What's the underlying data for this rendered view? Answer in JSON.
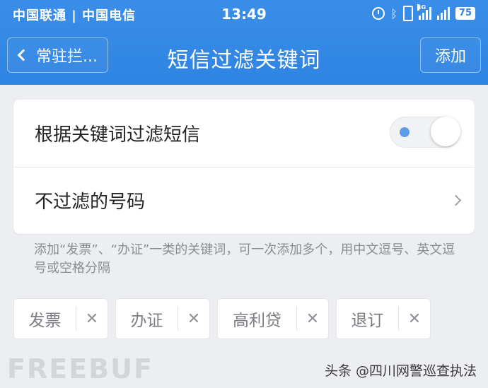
{
  "status_bar": {
    "carrier": "中国联通 | 中国电信",
    "time": "13:49",
    "network": "4G",
    "battery": "75",
    "icons": [
      "alarm-icon",
      "bluetooth-icon",
      "vibrate-icon",
      "signal-icon",
      "signal-icon"
    ]
  },
  "nav": {
    "back_label": "常驻拦...",
    "title": "短信过滤关键词",
    "add_label": "添加"
  },
  "settings": {
    "filter_by_keyword_label": "根据关键词过滤短信",
    "filter_by_keyword_enabled": false,
    "whitelist_label": "不过滤的号码"
  },
  "hint": "添加“发票”、“办证”一类的关键词，可一次添加多个，用中文逗号、英文逗号或空格分隔",
  "keywords": [
    {
      "label": "发票",
      "remove": "✕"
    },
    {
      "label": "办证",
      "remove": "✕"
    },
    {
      "label": "高利贷",
      "remove": "✕"
    },
    {
      "label": "退订",
      "remove": "✕"
    }
  ],
  "watermark": {
    "logo": "FREEBUF",
    "source": "头条 @四川网警巡查执法"
  },
  "colors": {
    "header_blue": "#2f84e2",
    "background": "#eceef1",
    "toggle_dot": "#5c9de9"
  }
}
